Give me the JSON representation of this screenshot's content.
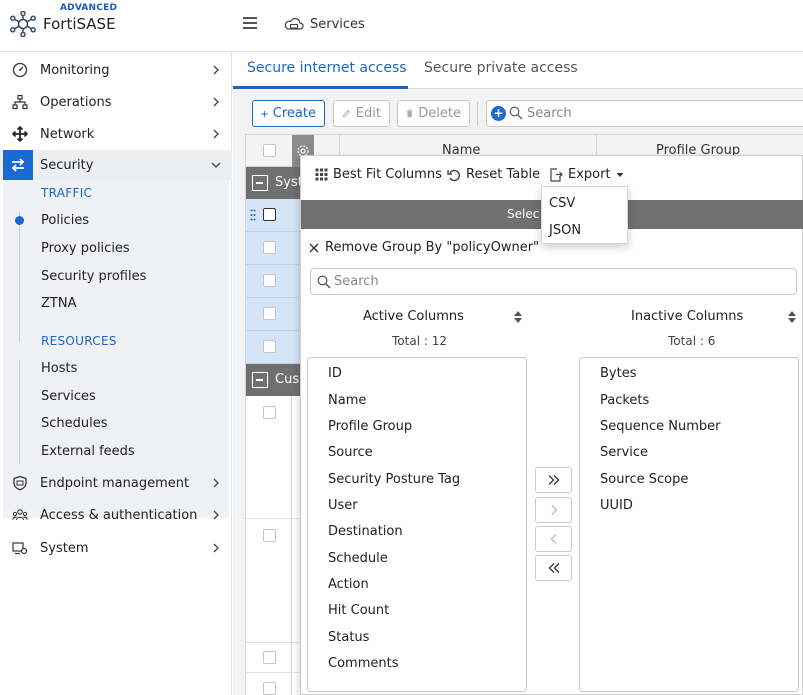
{
  "brand": {
    "badge": "ADVANCED",
    "name": "FortiSASE"
  },
  "header": {
    "crumb_label": "Services"
  },
  "sidebar": {
    "items": [
      {
        "label": "Monitoring",
        "icon": "monitoring-gauge-icon"
      },
      {
        "label": "Operations",
        "icon": "operations-hierarchy-icon"
      },
      {
        "label": "Network",
        "icon": "network-arrows-icon"
      },
      {
        "label": "Security",
        "icon": "security-swap-icon"
      },
      {
        "label": "Endpoint management",
        "icon": "endpoint-shield-icon"
      },
      {
        "label": "Access & authentication",
        "icon": "users-icon"
      },
      {
        "label": "System",
        "icon": "system-gear-icon"
      }
    ],
    "security_sections": [
      {
        "heading": "TRAFFIC",
        "items": [
          "Policies",
          "Proxy policies",
          "Security profiles",
          "ZTNA"
        ]
      },
      {
        "heading": "RESOURCES",
        "items": [
          "Hosts",
          "Services",
          "Schedules",
          "External feeds"
        ]
      }
    ]
  },
  "tabs": [
    {
      "label": "Secure internet access",
      "active": true
    },
    {
      "label": "Secure private access",
      "active": false
    }
  ],
  "toolbar": {
    "create": "Create",
    "edit": "Edit",
    "delete": "Delete",
    "search_placeholder": "Search"
  },
  "table": {
    "headers": {
      "name": "Name",
      "profile_group": "Profile Group"
    },
    "groups": [
      "Syst",
      "Cus"
    ]
  },
  "panel": {
    "best_fit": "Best Fit Columns",
    "reset": "Reset Table",
    "export": "Export",
    "bar_text": "Selec",
    "remove_group": "Remove Group By \"policyOwner\"",
    "search_placeholder": "Search",
    "active": {
      "title": "Active Columns",
      "total": "Total : 12",
      "items": [
        "ID",
        "Name",
        "Profile Group",
        "Source",
        "Security Posture Tag",
        "User",
        "Destination",
        "Schedule",
        "Action",
        "Hit Count",
        "Status",
        "Comments"
      ]
    },
    "inactive": {
      "title": "Inactive Columns",
      "total": "Total : 6",
      "items": [
        "Bytes",
        "Packets",
        "Sequence Number",
        "Service",
        "Source Scope",
        "UUID"
      ]
    }
  },
  "export_menu": [
    "CSV",
    "JSON"
  ],
  "colors": {
    "accent": "#1a66c6",
    "group_bar": "#707070",
    "selected_row": "#d6e4f7"
  }
}
